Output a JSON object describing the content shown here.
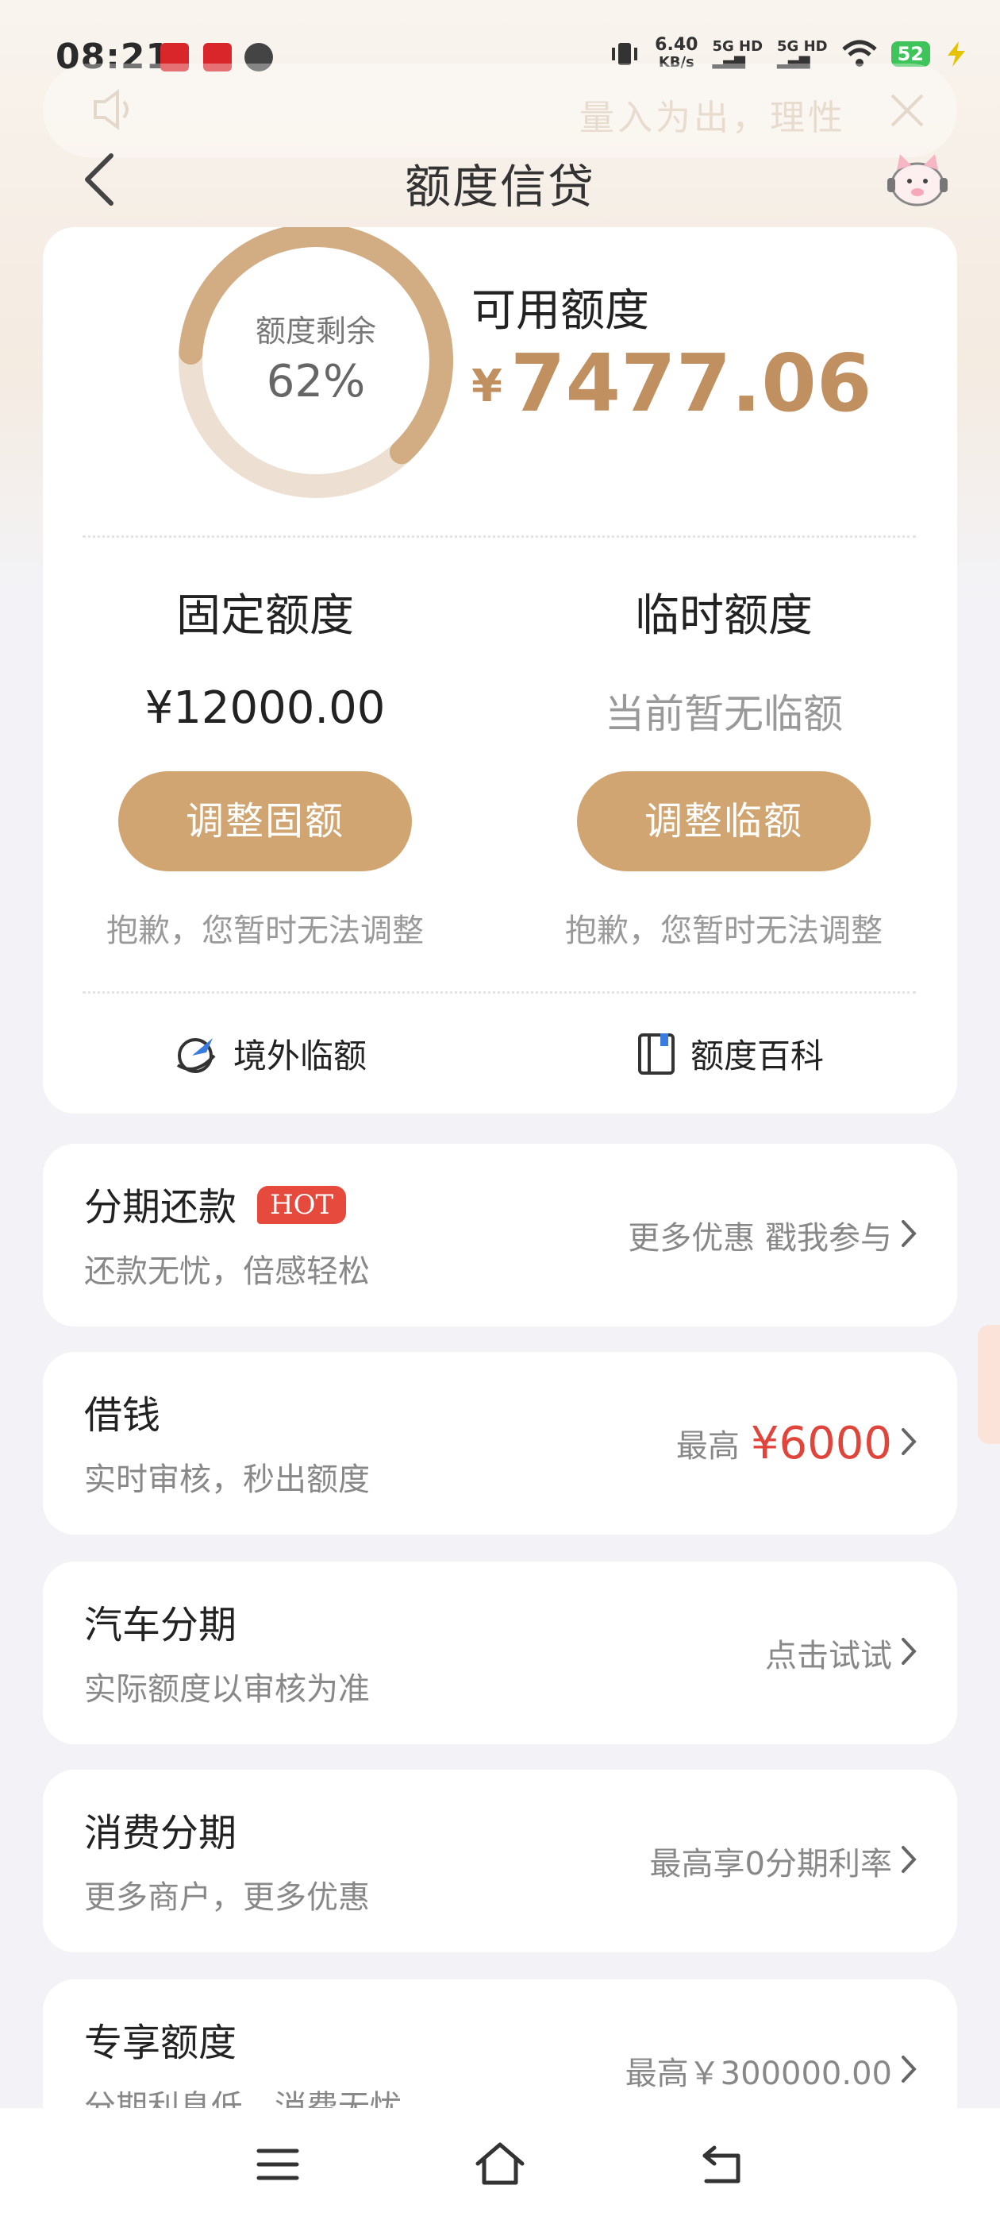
{
  "status_bar": {
    "time": "08:21",
    "net_speed_value": "6.40",
    "net_speed_unit": "KB/s",
    "signal_1": "5G HD",
    "signal_2": "5G HD",
    "battery": "52"
  },
  "notice": {
    "text": "量入为出，理性"
  },
  "header": {
    "title": "额度信贷"
  },
  "summary": {
    "ring_label": "额度剩余",
    "ring_value": "62%",
    "ring_percent": 0.62,
    "available_label": "可用额度",
    "currency": "¥",
    "available_amount": "7477.06"
  },
  "fixed": {
    "title": "固定额度",
    "amount": "¥12000.00",
    "button": "调整固额",
    "note": "抱歉，您暂时无法调整"
  },
  "temporary": {
    "title": "临时额度",
    "amount": "当前暂无临额",
    "button": "调整临额",
    "note": "抱歉，您暂时无法调整"
  },
  "links": {
    "overseas": "境外临额",
    "encyclopedia": "额度百科"
  },
  "services": [
    {
      "title": "分期还款",
      "badge": "HOT",
      "subtitle": "还款无忧，倍感轻松",
      "right": "更多优惠 戳我参与"
    },
    {
      "title": "借钱",
      "subtitle": "实时审核，秒出额度",
      "right_prefix": "最高",
      "right_highlight": "¥6000"
    },
    {
      "title": "汽车分期",
      "subtitle": "实际额度以审核为准",
      "right": "点击试试"
    },
    {
      "title": "消费分期",
      "subtitle": "更多商户，更多优惠",
      "right": "最高享0分期利率"
    },
    {
      "title": "专享额度",
      "subtitle": "分期利息低，消费无忧",
      "right": "最高￥300000.00"
    }
  ],
  "colors": {
    "accent": "#d0a572",
    "accent_text": "#c09060",
    "highlight_red": "#e0443a",
    "hot_badge": "#e64a3c"
  }
}
